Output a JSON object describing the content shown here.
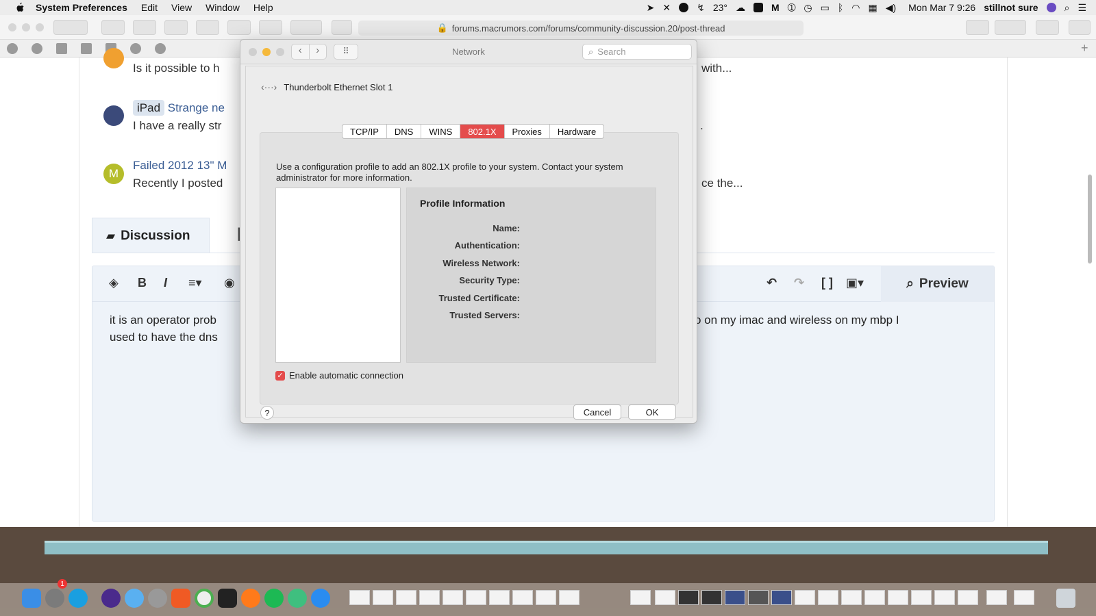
{
  "menubar": {
    "app": "System Preferences",
    "menus": [
      "Edit",
      "View",
      "Window",
      "Help"
    ],
    "temperature": "23°",
    "datetime": "Mon Mar 7  9:26",
    "user": "stillnot sure"
  },
  "browser": {
    "url": "forums.macrumors.com/forums/community-discussion.20/post-thread"
  },
  "threads": [
    {
      "prefix": "",
      "title": "",
      "snippet": "Is it possible to h",
      "snippet_tail": "with..."
    },
    {
      "prefix": "iPad",
      "title": "Strange ne",
      "snippet": "I have a really str",
      "snippet_tail": "."
    },
    {
      "avatar_letter": "M",
      "title": "Failed 2012 13\" M",
      "snippet": "Recently I posted",
      "snippet_tail": "ce the..."
    }
  ],
  "editor": {
    "tab_label": "Discussion",
    "preview_label": "Preview",
    "text_line1_left": "it is an operator prob",
    "text_line1_right": "o on my imac and wireless on my mbp I",
    "text_line2_left": "used to have the dns"
  },
  "dialog": {
    "window_title": "Network",
    "search_placeholder": "Search",
    "interface_name": "Thunderbolt Ethernet Slot 1",
    "tabs": [
      "TCP/IP",
      "DNS",
      "WINS",
      "802.1X",
      "Proxies",
      "Hardware"
    ],
    "active_tab": "802.1X",
    "description": "Use a configuration profile to add an 802.1X profile to your system. Contact your system administrator for more information.",
    "profile_heading": "Profile Information",
    "fields": [
      "Name:",
      "Authentication:",
      "Wireless Network:",
      "Security Type:",
      "Trusted Certificate:",
      "Trusted Servers:"
    ],
    "checkbox_label": "Enable automatic connection",
    "checkbox_checked": true,
    "help": "?",
    "cancel": "Cancel",
    "ok": "OK"
  },
  "dock": {
    "badge": "1"
  }
}
